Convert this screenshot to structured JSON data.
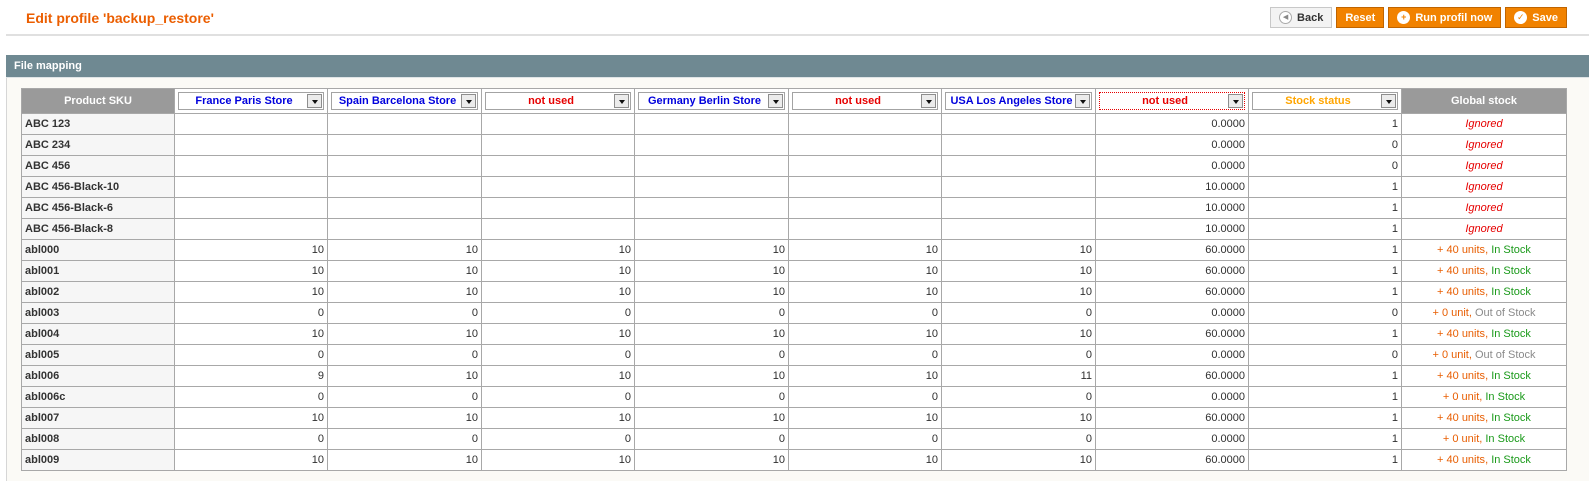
{
  "header": {
    "title": "Edit profile 'backup_restore'",
    "buttons": {
      "back": "Back",
      "reset": "Reset",
      "run": "Run profil now",
      "save": "Save"
    }
  },
  "section": {
    "title": "File mapping"
  },
  "grid": {
    "sku_header": "Product SKU",
    "global_header": "Global stock",
    "selects": [
      {
        "value": "France Paris Store",
        "color": "#0000dd"
      },
      {
        "value": "Spain Barcelona Store",
        "color": "#0000dd"
      },
      {
        "value": "not used",
        "color": "#e60000"
      },
      {
        "value": "Germany Berlin Store",
        "color": "#0000dd"
      },
      {
        "value": "not used",
        "color": "#e60000"
      },
      {
        "value": "USA Los Angeles Store",
        "color": "#0000dd"
      },
      {
        "value": "not used",
        "color": "#e60000"
      },
      {
        "value": "Stock status",
        "color": "#ffa500"
      }
    ],
    "rows": [
      {
        "sku": "ABC 123",
        "c1": "",
        "c2": "",
        "c3": "",
        "c4": "",
        "c5": "",
        "c6": "",
        "c7": "0.0000",
        "c8": "1",
        "g1": "Ignored",
        "g2": "",
        "g3": ""
      },
      {
        "sku": "ABC 234",
        "c1": "",
        "c2": "",
        "c3": "",
        "c4": "",
        "c5": "",
        "c6": "",
        "c7": "0.0000",
        "c8": "0",
        "g1": "Ignored",
        "g2": "",
        "g3": ""
      },
      {
        "sku": "ABC 456",
        "c1": "",
        "c2": "",
        "c3": "",
        "c4": "",
        "c5": "",
        "c6": "",
        "c7": "0.0000",
        "c8": "0",
        "g1": "Ignored",
        "g2": "",
        "g3": ""
      },
      {
        "sku": "ABC 456-Black-10",
        "c1": "",
        "c2": "",
        "c3": "",
        "c4": "",
        "c5": "",
        "c6": "",
        "c7": "10.0000",
        "c8": "1",
        "g1": "Ignored",
        "g2": "",
        "g3": ""
      },
      {
        "sku": "ABC 456-Black-6",
        "c1": "",
        "c2": "",
        "c3": "",
        "c4": "",
        "c5": "",
        "c6": "",
        "c7": "10.0000",
        "c8": "1",
        "g1": "Ignored",
        "g2": "",
        "g3": ""
      },
      {
        "sku": "ABC 456-Black-8",
        "c1": "",
        "c2": "",
        "c3": "",
        "c4": "",
        "c5": "",
        "c6": "",
        "c7": "10.0000",
        "c8": "1",
        "g1": "Ignored",
        "g2": "",
        "g3": ""
      },
      {
        "sku": "abl000",
        "c1": "10",
        "c2": "10",
        "c3": "10",
        "c4": "10",
        "c5": "10",
        "c6": "10",
        "c7": "60.0000",
        "c8": "1",
        "g1": "",
        "g2": "+ 40 units",
        "g3": "In Stock"
      },
      {
        "sku": "abl001",
        "c1": "10",
        "c2": "10",
        "c3": "10",
        "c4": "10",
        "c5": "10",
        "c6": "10",
        "c7": "60.0000",
        "c8": "1",
        "g1": "",
        "g2": "+ 40 units",
        "g3": "In Stock"
      },
      {
        "sku": "abl002",
        "c1": "10",
        "c2": "10",
        "c3": "10",
        "c4": "10",
        "c5": "10",
        "c6": "10",
        "c7": "60.0000",
        "c8": "1",
        "g1": "",
        "g2": "+ 40 units",
        "g3": "In Stock"
      },
      {
        "sku": "abl003",
        "c1": "0",
        "c2": "0",
        "c3": "0",
        "c4": "0",
        "c5": "0",
        "c6": "0",
        "c7": "0.0000",
        "c8": "0",
        "g1": "",
        "g2": "+ 0 unit",
        "g3": "Out of Stock"
      },
      {
        "sku": "abl004",
        "c1": "10",
        "c2": "10",
        "c3": "10",
        "c4": "10",
        "c5": "10",
        "c6": "10",
        "c7": "60.0000",
        "c8": "1",
        "g1": "",
        "g2": "+ 40 units",
        "g3": "In Stock"
      },
      {
        "sku": "abl005",
        "c1": "0",
        "c2": "0",
        "c3": "0",
        "c4": "0",
        "c5": "0",
        "c6": "0",
        "c7": "0.0000",
        "c8": "0",
        "g1": "",
        "g2": "+ 0 unit",
        "g3": "Out of Stock"
      },
      {
        "sku": "abl006",
        "c1": "9",
        "c2": "10",
        "c3": "10",
        "c4": "10",
        "c5": "10",
        "c6": "11",
        "c7": "60.0000",
        "c8": "1",
        "g1": "",
        "g2": "+ 40 units",
        "g3": "In Stock"
      },
      {
        "sku": "abl006c",
        "c1": "0",
        "c2": "0",
        "c3": "0",
        "c4": "0",
        "c5": "0",
        "c6": "0",
        "c7": "0.0000",
        "c8": "1",
        "g1": "",
        "g2": "+ 0 unit",
        "g3": "In Stock"
      },
      {
        "sku": "abl007",
        "c1": "10",
        "c2": "10",
        "c3": "10",
        "c4": "10",
        "c5": "10",
        "c6": "10",
        "c7": "60.0000",
        "c8": "1",
        "g1": "",
        "g2": "+ 40 units",
        "g3": "In Stock"
      },
      {
        "sku": "abl008",
        "c1": "0",
        "c2": "0",
        "c3": "0",
        "c4": "0",
        "c5": "0",
        "c6": "0",
        "c7": "0.0000",
        "c8": "1",
        "g1": "",
        "g2": "+ 0 unit",
        "g3": "In Stock"
      },
      {
        "sku": "abl009",
        "c1": "10",
        "c2": "10",
        "c3": "10",
        "c4": "10",
        "c5": "10",
        "c6": "10",
        "c7": "60.0000",
        "c8": "1",
        "g1": "",
        "g2": "+ 40 units",
        "g3": "In Stock"
      }
    ]
  }
}
